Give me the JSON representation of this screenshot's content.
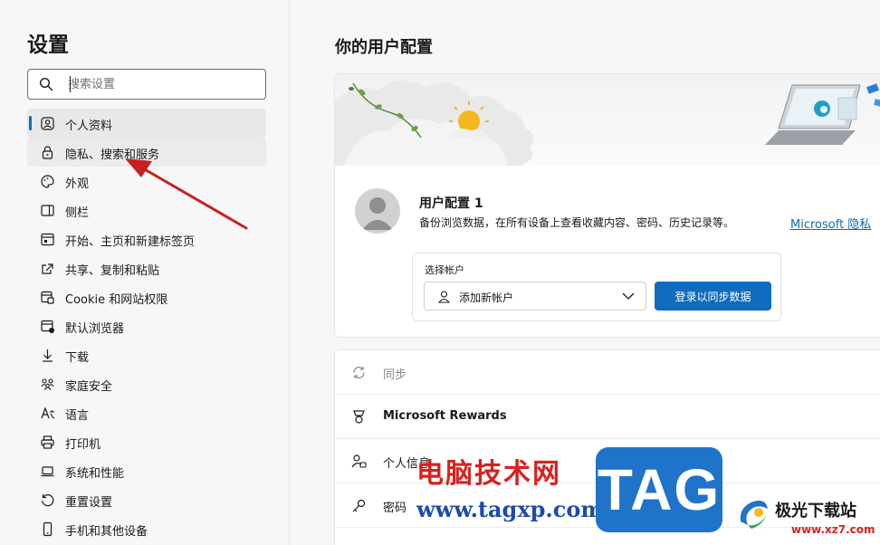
{
  "sidebar": {
    "title": "设置",
    "search": {
      "placeholder": "搜索设置",
      "value": ""
    },
    "items": [
      {
        "label": "个人资料",
        "icon": "profile-icon",
        "state": "active"
      },
      {
        "label": "隐私、搜索和服务",
        "icon": "lock-icon",
        "state": "hover"
      },
      {
        "label": "外观",
        "icon": "palette-icon"
      },
      {
        "label": "侧栏",
        "icon": "sidebar-icon"
      },
      {
        "label": "开始、主页和新建标签页",
        "icon": "home-icon"
      },
      {
        "label": "共享、复制和粘贴",
        "icon": "share-icon"
      },
      {
        "label": "Cookie 和网站权限",
        "icon": "cookie-icon"
      },
      {
        "label": "默认浏览器",
        "icon": "browser-icon"
      },
      {
        "label": "下载",
        "icon": "download-icon"
      },
      {
        "label": "家庭安全",
        "icon": "family-icon"
      },
      {
        "label": "语言",
        "icon": "language-icon"
      },
      {
        "label": "打印机",
        "icon": "printer-icon"
      },
      {
        "label": "系统和性能",
        "icon": "laptop-icon"
      },
      {
        "label": "重置设置",
        "icon": "reset-icon"
      },
      {
        "label": "手机和其他设备",
        "icon": "phone-icon"
      }
    ]
  },
  "main": {
    "title": "你的用户配置",
    "profile": {
      "name": "用户配置 1",
      "description": "备份浏览数据，在所有设备上查看收藏内容、密码、历史记录等。",
      "link": "Microsoft 隐私"
    },
    "account": {
      "label": "选择帐户",
      "selected": "添加新帐户",
      "signin_button": "登录以同步数据"
    },
    "rows": [
      {
        "label": "同步",
        "icon": "sync-icon",
        "disabled": true
      },
      {
        "label": "Microsoft Rewards",
        "icon": "rewards-icon",
        "bold": true
      },
      {
        "label": "个人信息",
        "icon": "person-info-icon"
      },
      {
        "label": "密码",
        "icon": "key-icon"
      }
    ]
  },
  "watermark": {
    "cn_text": "电脑技术网",
    "url": "www.tagxp.com",
    "tag": "TAG",
    "site_name": "极光下载站",
    "site_url": "www.xz7.com"
  },
  "colors": {
    "accent": "#0f6cbd",
    "watermark_red": "#d7221e",
    "watermark_blue": "#1f74c9"
  }
}
